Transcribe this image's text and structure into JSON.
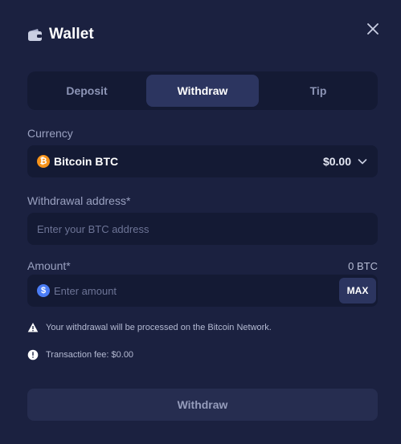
{
  "header": {
    "title": "Wallet",
    "icon": "wallet-icon",
    "close_icon": "close-icon"
  },
  "tabs": [
    {
      "label": "Deposit",
      "active": false
    },
    {
      "label": "Withdraw",
      "active": true
    },
    {
      "label": "Tip",
      "active": false
    }
  ],
  "currency": {
    "label": "Currency",
    "coin_symbol": "₿",
    "name": "Bitcoin BTC",
    "balance": "$0.00",
    "icon": "chevron-down-icon"
  },
  "address": {
    "label": "Withdrawal address*",
    "placeholder": "Enter your BTC address",
    "value": ""
  },
  "amount": {
    "label": "Amount*",
    "balance": "0 BTC",
    "coin_symbol": "$",
    "placeholder": "Enter amount",
    "value": "",
    "max_label": "MAX"
  },
  "notices": {
    "network": "Your withdrawal will be processed on the Bitcoin Network.",
    "fee": "Transaction fee: $0.00"
  },
  "submit": {
    "label": "Withdraw"
  },
  "colors": {
    "background": "#1b2140",
    "field": "#141a34",
    "active_tab": "#2c3560",
    "bitcoin": "#f7931a",
    "usd": "#4a7cf5"
  }
}
